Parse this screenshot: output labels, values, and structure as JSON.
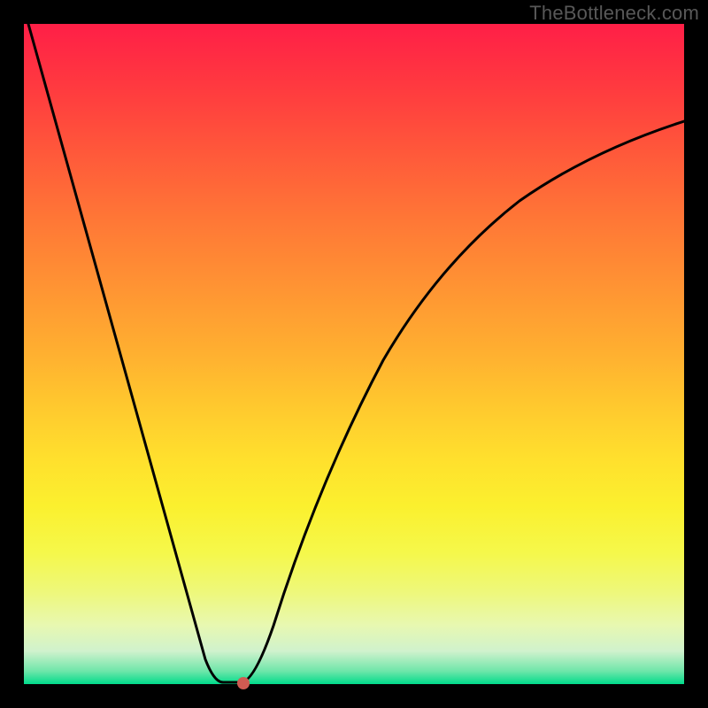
{
  "watermark": "TheBottleneck.com",
  "colors": {
    "frame": "#000000",
    "gradient_top": "#ff1f47",
    "gradient_bottom": "#00db8b",
    "curve": "#000000",
    "marker": "#cf5b52",
    "watermark_text": "#585858"
  },
  "chart_data": {
    "type": "line",
    "title": "",
    "xlabel": "",
    "ylabel": "",
    "xlim": [
      0,
      100
    ],
    "ylim": [
      0,
      100
    ],
    "grid": false,
    "x": [
      0,
      5,
      10,
      15,
      20,
      25,
      28,
      30,
      32,
      33,
      35,
      40,
      45,
      50,
      55,
      60,
      65,
      70,
      75,
      80,
      85,
      90,
      95,
      100
    ],
    "values": [
      100,
      84,
      68,
      52,
      36,
      20,
      6,
      1,
      0,
      0,
      5,
      22,
      36,
      48,
      57,
      64,
      70,
      75,
      78,
      81,
      83,
      85,
      86,
      87
    ],
    "optimal_point": {
      "x": 33,
      "y": 0
    },
    "note": "Values estimated from pixel positions; y = bottleneck percentage (0 at bottom green band, 100 at top red)."
  }
}
